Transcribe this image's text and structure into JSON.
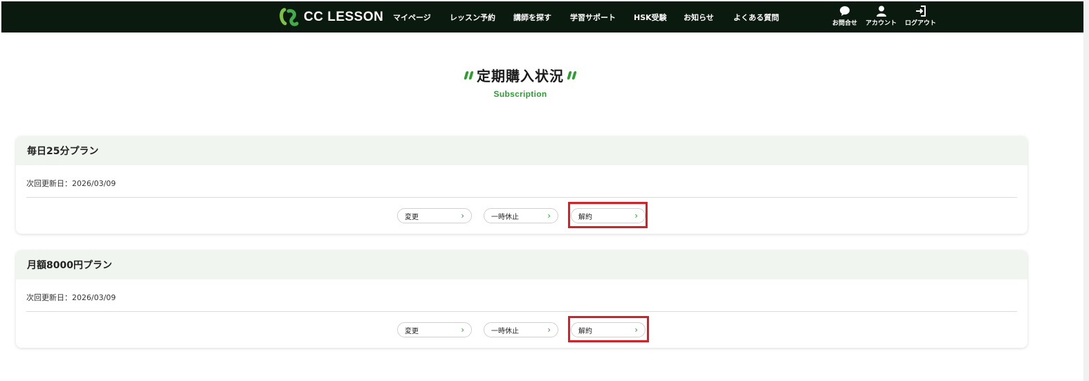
{
  "header": {
    "logo_text": "CC LESSON",
    "nav": [
      {
        "label": "マイページ"
      },
      {
        "label": "レッスン予約"
      },
      {
        "label": "講師を探す"
      },
      {
        "label": "学習サポート"
      },
      {
        "label": "HSK受験"
      },
      {
        "label": "お知らせ"
      },
      {
        "label": "よくある質問"
      }
    ],
    "utils": [
      {
        "label": "お問合せ",
        "icon": "chat-icon"
      },
      {
        "label": "アカウント",
        "icon": "user-icon"
      },
      {
        "label": "ログアウト",
        "icon": "logout-icon"
      }
    ]
  },
  "page": {
    "title": "定期購入状況",
    "subtitle": "Subscription"
  },
  "subscriptions": [
    {
      "plan": "毎日25分プラン",
      "renewal": "次回更新日：2026/03/09",
      "change_label": "変更",
      "pause_label": "一時休止",
      "cancel_label": "解約"
    },
    {
      "plan": "月額8000円プラン",
      "renewal": "次回更新日：2026/03/09",
      "change_label": "変更",
      "pause_label": "一時休止",
      "cancel_label": "解約"
    }
  ],
  "colors": {
    "header_bg": "#0b1a0f",
    "accent_green": "#2a9d2f",
    "card_head_bg": "#f0f6ef",
    "highlight_red": "#e11b22"
  }
}
